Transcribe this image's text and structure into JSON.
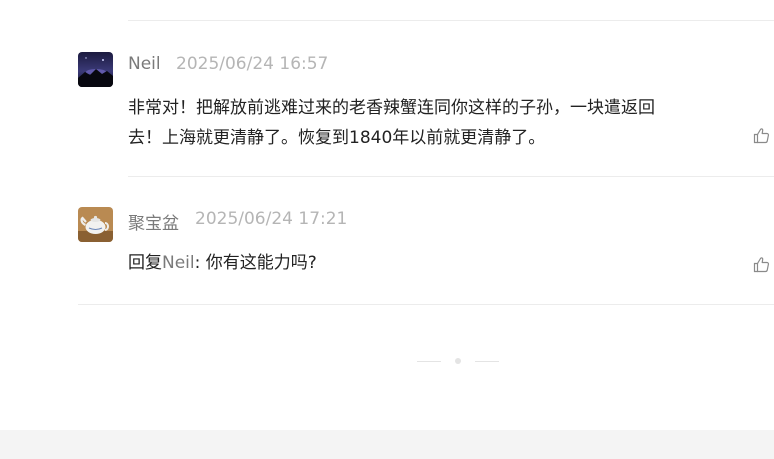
{
  "comments": [
    {
      "author": "Neil",
      "time": "2025/06/24 16:57",
      "content_line1": "非常对！把解放前逃难过来的老香辣蟹连同你这样的子孙，一块遣返回",
      "content_line2": "去！上海就更清静了。恢复到1840年以前就更清静了。",
      "avatar_icon": "night-landscape-avatar",
      "like_icon": "thumbs-up-icon"
    },
    {
      "author": "聚宝盆",
      "time": "2025/06/24 17:21",
      "reply_prefix": "回复",
      "reply_to": "Neil",
      "reply_text": ": 你有这能力吗?",
      "avatar_icon": "teapot-avatar",
      "like_icon": "thumbs-up-icon"
    }
  ],
  "colors": {
    "author": "#7a7a7a",
    "time": "#b5b5b5",
    "text": "#222222",
    "divider": "#ececec",
    "footer": "#f4f4f4"
  }
}
